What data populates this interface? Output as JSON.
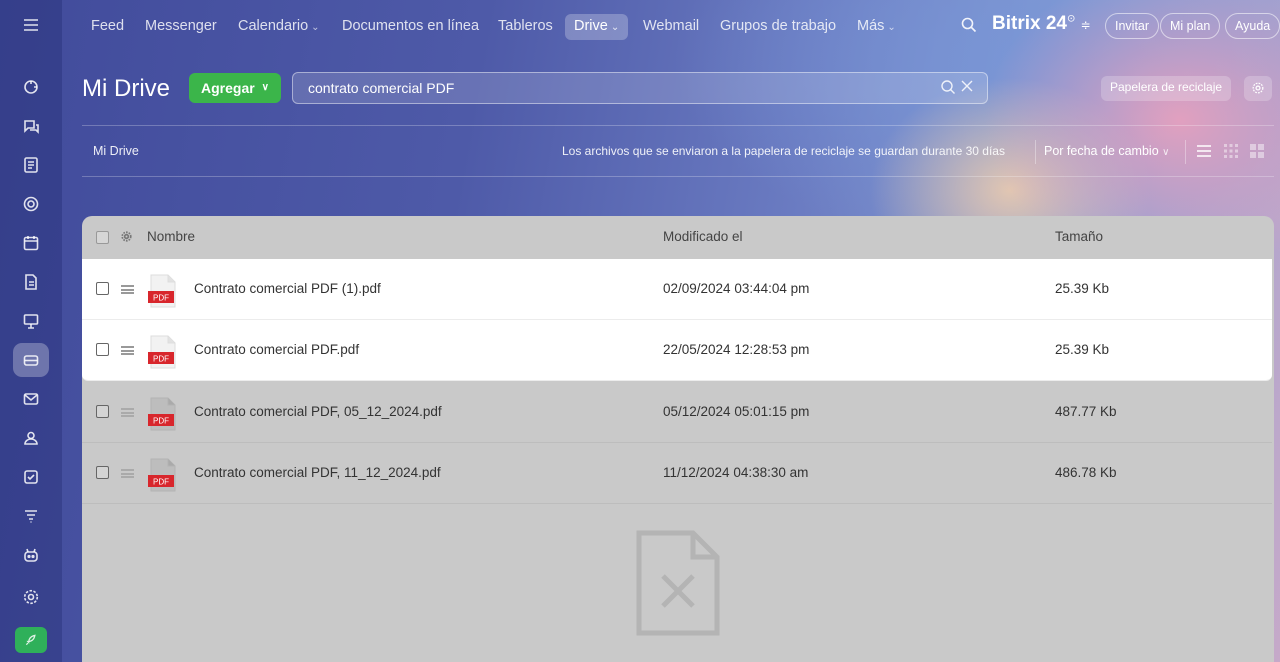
{
  "nav": {
    "items": [
      {
        "label": "Feed",
        "dropdown": false
      },
      {
        "label": "Messenger",
        "dropdown": false
      },
      {
        "label": "Calendario",
        "dropdown": true
      },
      {
        "label": "Documentos en línea",
        "dropdown": false
      },
      {
        "label": "Tableros",
        "dropdown": false
      },
      {
        "label": "Drive",
        "dropdown": true,
        "active": true
      },
      {
        "label": "Webmail",
        "dropdown": false
      },
      {
        "label": "Grupos de trabajo",
        "dropdown": false
      },
      {
        "label": "Más",
        "dropdown": true
      }
    ],
    "brand": "Bitrix 24",
    "invite": "Invitar",
    "my_plan": "Mi plan",
    "help": "Ayuda",
    "chevron": "⌄"
  },
  "header": {
    "title": "Mi Drive",
    "add_label": "Agregar",
    "add_chevron": "∨",
    "search_value": "contrato comercial PDF",
    "trash_label": "Papelera de reciclaje"
  },
  "toolbar": {
    "breadcrumb": "Mi Drive",
    "trash_note": "Los archivos que se enviaron a la papelera de reciclaje se guardan durante 30 días",
    "sort_label": "Por fecha de cambio",
    "sort_chevron": "∨"
  },
  "table": {
    "columns": {
      "name": "Nombre",
      "modified": "Modificado el",
      "size": "Tamaño"
    },
    "rows": [
      {
        "name": "Contrato comercial PDF (1).pdf",
        "modified": "02/09/2024 03:44:04 pm",
        "size": "25.39 Kb",
        "highlighted": true,
        "badge": "PDF"
      },
      {
        "name": "Contrato comercial PDF.pdf",
        "modified": "22/05/2024 12:28:53 pm",
        "size": "25.39 Kb",
        "highlighted": true,
        "badge": "PDF"
      },
      {
        "name": "Contrato comercial PDF, 05_12_2024.pdf",
        "modified": "05/12/2024 05:01:15 pm",
        "size": "487.77 Kb",
        "highlighted": false,
        "badge": "PDF"
      },
      {
        "name": "Contrato comercial PDF, 11_12_2024.pdf",
        "modified": "11/12/2024 04:38:30 am",
        "size": "486.78 Kb",
        "highlighted": false,
        "badge": "PDF"
      }
    ]
  },
  "colors": {
    "accent_green": "#3bb54a",
    "pdf_red": "#d8262c",
    "rocket_green": "#2fb05a"
  }
}
